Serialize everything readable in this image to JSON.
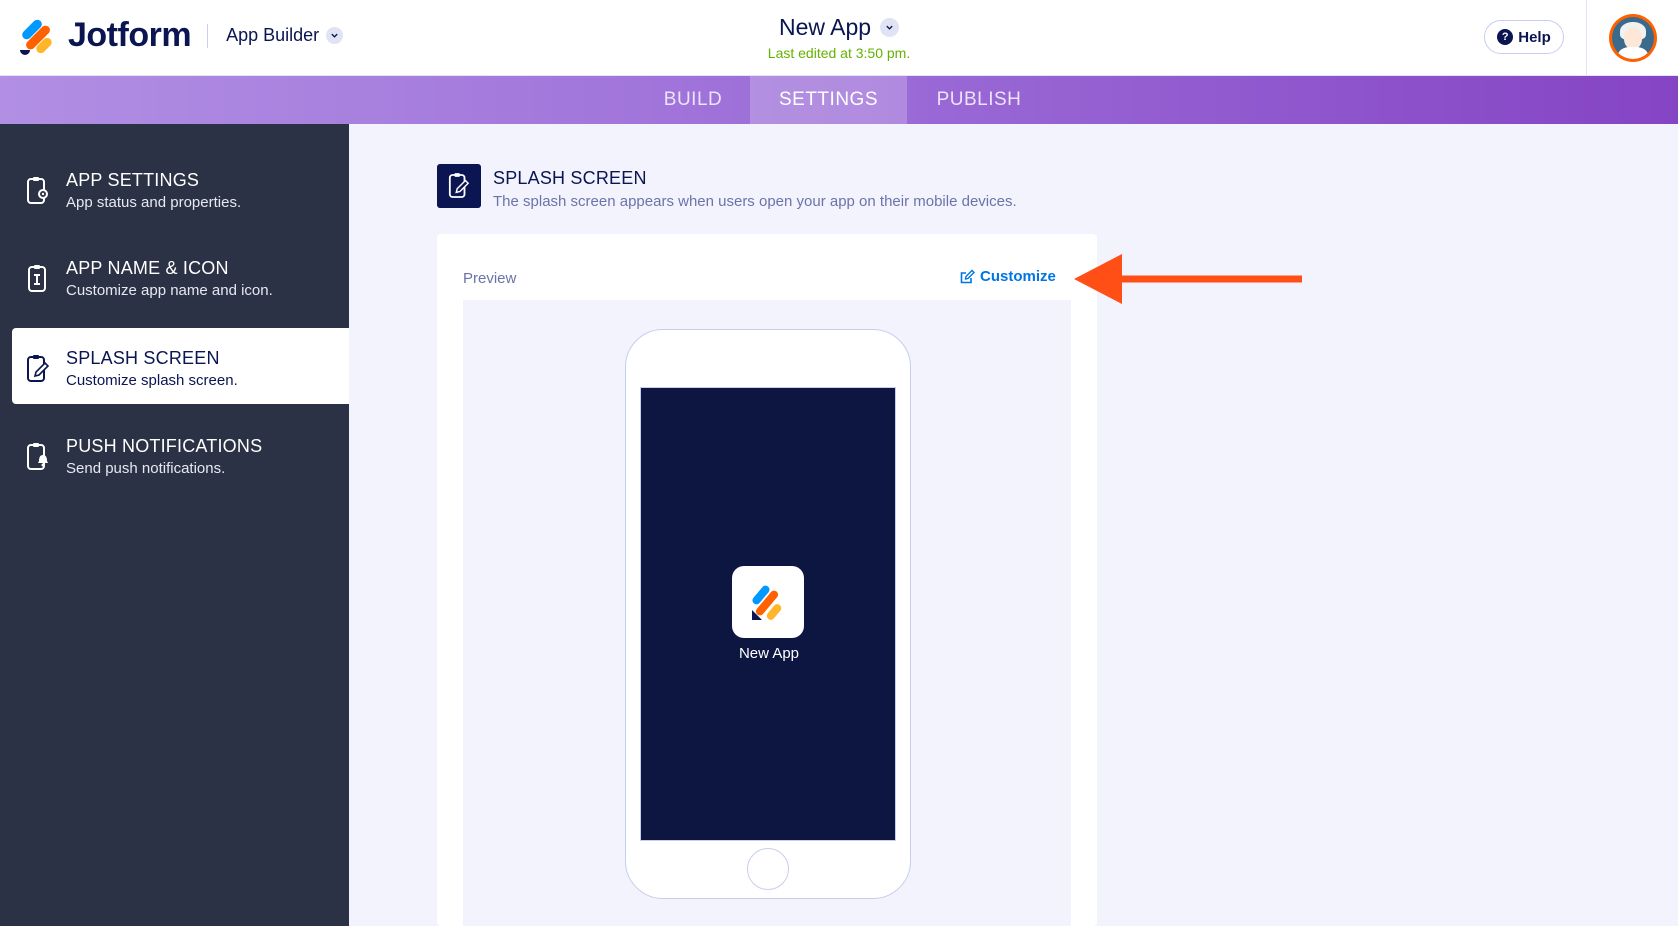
{
  "header": {
    "brand": "Jotform",
    "product_menu": "App Builder",
    "app_title": "New App",
    "last_edited": "Last edited at 3:50 pm.",
    "help_label": "Help"
  },
  "tabs": [
    {
      "label": "BUILD",
      "active": false
    },
    {
      "label": "SETTINGS",
      "active": true
    },
    {
      "label": "PUBLISH",
      "active": false
    }
  ],
  "sidebar": {
    "items": [
      {
        "title": "APP SETTINGS",
        "desc": "App status and properties.",
        "icon": "settings-phone-icon",
        "active": false
      },
      {
        "title": "APP NAME & ICON",
        "desc": "Customize app name and icon.",
        "icon": "name-icon-phone-icon",
        "active": false
      },
      {
        "title": "SPLASH SCREEN",
        "desc": "Customize splash screen.",
        "icon": "splash-edit-icon",
        "active": true
      },
      {
        "title": "PUSH NOTIFICATIONS",
        "desc": "Send push notifications.",
        "icon": "notification-phone-icon",
        "active": false
      }
    ]
  },
  "main": {
    "section_title": "SPLASH SCREEN",
    "section_desc": "The splash screen appears when users open your app on their mobile devices.",
    "preview_label": "Preview",
    "customize_label": "Customize",
    "splash_app_name": "New App",
    "splash_bg_color": "#0d1541"
  },
  "colors": {
    "accent": "#0075e3",
    "navy": "#0a1551",
    "edited_green": "#64b200",
    "annotation_arrow": "#ff4f17"
  }
}
